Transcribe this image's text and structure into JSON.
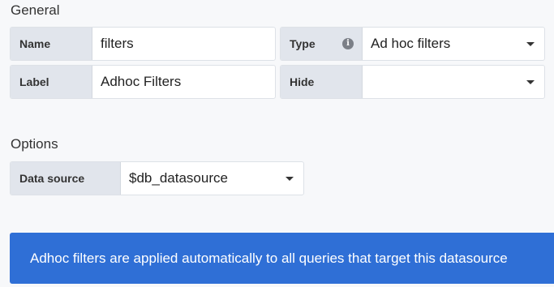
{
  "general": {
    "title": "General",
    "name": {
      "label": "Name",
      "value": "filters"
    },
    "type": {
      "label": "Type",
      "info_icon": "info-circle-icon",
      "value": "Ad hoc filters"
    },
    "label": {
      "label": "Label",
      "value": "Adhoc Filters"
    },
    "hide": {
      "label": "Hide",
      "value": ""
    }
  },
  "options": {
    "title": "Options",
    "data_source": {
      "label": "Data source",
      "value": "$db_datasource"
    }
  },
  "info_banner": {
    "text": "Adhoc filters are applied automatically to all queries that target this datasource",
    "color": "#2f6fd6"
  }
}
